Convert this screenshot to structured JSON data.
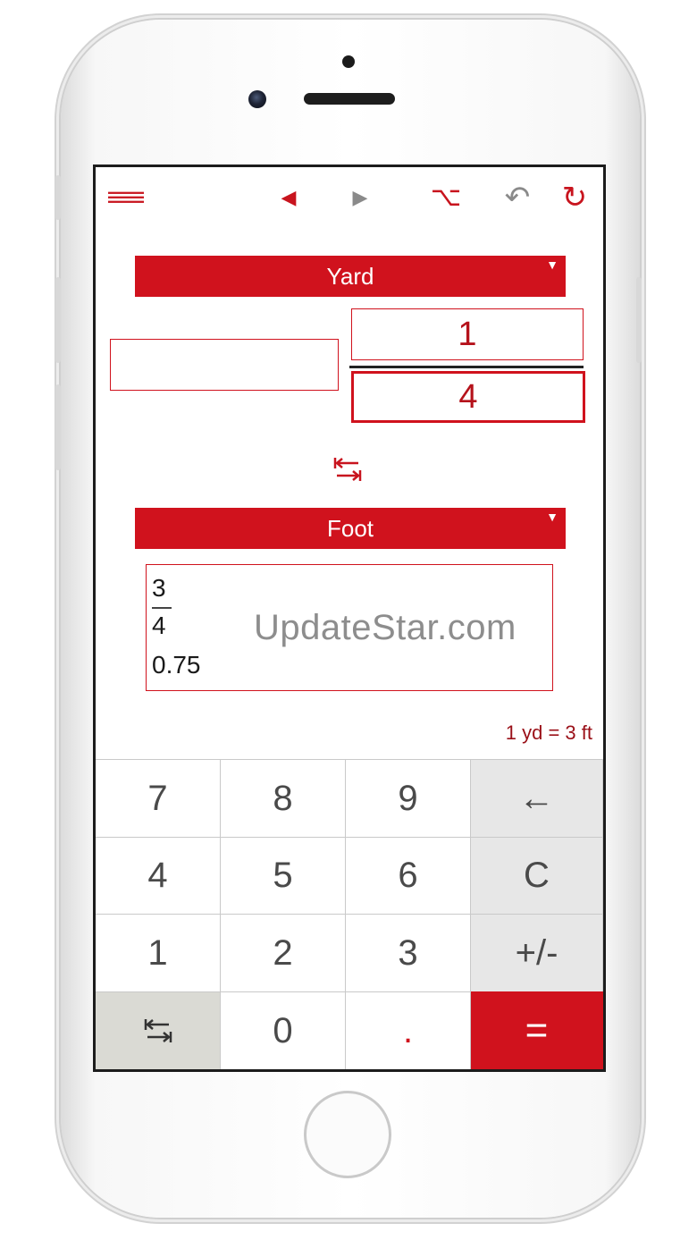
{
  "toolbar": {
    "menu_icon": "menu-icon",
    "prev_icon": "◀",
    "next_icon": "▶",
    "option_icon": "⌥",
    "undo_icon": "↶",
    "refresh_icon": "↻"
  },
  "from_unit": {
    "label": "Yard",
    "caret": "▼",
    "whole_value": "",
    "numerator": "1",
    "denominator": "4"
  },
  "swap_icon": "⇆",
  "to_unit": {
    "label": "Foot",
    "caret": "▼"
  },
  "result": {
    "numerator": "3",
    "denominator": "4",
    "decimal": "0.75"
  },
  "watermark": "UpdateStar.com",
  "conversion_note": "1 yd = 3 ft",
  "keypad": {
    "k7": "7",
    "k8": "8",
    "k9": "9",
    "backspace": "←",
    "k4": "4",
    "k5": "5",
    "k6": "6",
    "clear": "C",
    "k1": "1",
    "k2": "2",
    "k3": "3",
    "sign": "+/-",
    "swap": "⇆",
    "k0": "0",
    "dot": ".",
    "equals": "="
  },
  "colors": {
    "accent": "#d0121d",
    "operator_key_bg": "#e7e7e7",
    "swap_key_bg": "#dadad4"
  }
}
